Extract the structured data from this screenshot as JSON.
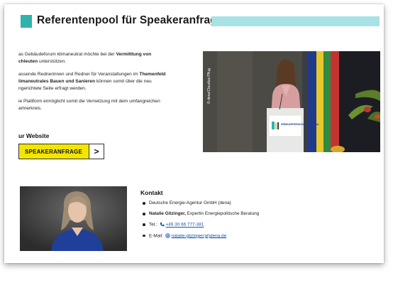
{
  "header": {
    "title": "Referentenpool für Speakeranfragen",
    "accent_color": "#2fb3ad",
    "bar_color": "#a9e2e4"
  },
  "intro": {
    "p1_a": "as Gebäudeforum klimaneutral möchte bei der ",
    "p1_b": "Vermittlung von",
    "p1_c": "chleuten",
    "p1_d": " unterstützen.",
    "p2_a": "assende Rednerinnen und Redner für Veranstaltungen im ",
    "p2_b": "Themenfeld",
    "p2_c": "limaneutrales Bauen und Sanieren",
    "p2_d": " können somit über die neu",
    "p2_e": "ngerichtete Seite erfragt werden.",
    "p3_a": "ie Plattform ermöglicht somit die Vernetzung mit dem umfangreichen",
    "p3_b": "artnerkreis."
  },
  "website": {
    "heading": "ur Website",
    "cta_label": "SPEAKERANFRAGE",
    "cta_arrow": ">",
    "cta_color": "#f2e600"
  },
  "photo": {
    "credit": "© dena/Claudius Pflug",
    "sign_text": "GEBÄUDEFORUM KLIMANEUTRAL",
    "icon": "speaker-at-podium-photo"
  },
  "portrait": {
    "icon": "portrait-photo"
  },
  "kontakt": {
    "title": "Kontakt",
    "org": "Deutsche Energie-Agentur GmbH (dena)",
    "name": "Natalie Gitzinger,",
    "role": " Expertin Energiepolitische Beratung",
    "tel_label": "Tel.: ",
    "tel": "+49 30 66 777-381",
    "mail_label": "E-Mail: ",
    "mail": "natalie.gitzinger(at)dena.de"
  }
}
